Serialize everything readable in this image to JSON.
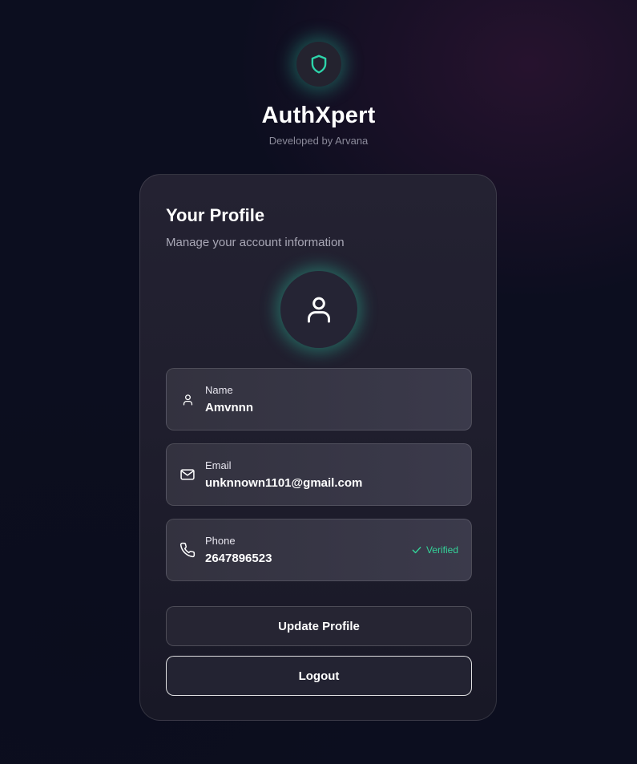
{
  "brand": {
    "title": "AuthXpert",
    "subtitle": "Developed by Arvana",
    "logo_icon": "shield-icon"
  },
  "profile": {
    "title": "Your Profile",
    "subtitle": "Manage your account information",
    "avatar_icon": "user-icon",
    "fields": [
      {
        "label": "Name",
        "value": "Amvnnn",
        "icon": "user-icon"
      },
      {
        "label": "Email",
        "value": "unknnown1101@gmail.com",
        "icon": "mail-icon"
      },
      {
        "label": "Phone",
        "value": "2647896523",
        "icon": "phone-icon",
        "badge": "Verified"
      }
    ]
  },
  "actions": {
    "update_label": "Update Profile",
    "logout_label": "Logout"
  },
  "colors": {
    "accent": "#2dd4aa",
    "verified": "#34d399",
    "background": "#0c0e1f",
    "card": "#1e1d2c"
  }
}
